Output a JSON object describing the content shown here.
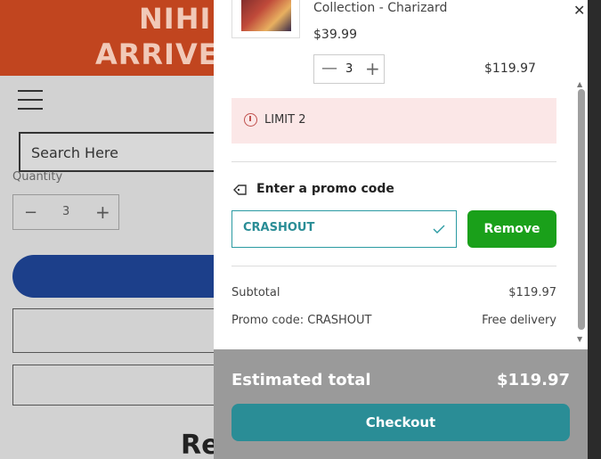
{
  "background": {
    "banner": {
      "line1": "NIHIL",
      "line2": "ARRIVE"
    },
    "search_placeholder": "Search Here",
    "quantity_label": "Quantity",
    "quantity_stepper": {
      "minus": "−",
      "value": "3",
      "plus": "+"
    },
    "heading_fragment": "Re"
  },
  "cart": {
    "item": {
      "title": "Collection - Charizard",
      "unit_price": "$39.99",
      "quantity": "3",
      "line_total": "$119.97"
    },
    "limit_notice": "LIMIT 2",
    "promo": {
      "title": "Enter a promo code",
      "code_value": "CRASHOUT",
      "remove_label": "Remove"
    },
    "summary": [
      {
        "label": "Subtotal",
        "value": "$119.97"
      },
      {
        "label": "Promo code: CRASHOUT",
        "value": "Free delivery"
      }
    ],
    "footer": {
      "estimated_label": "Estimated total",
      "estimated_value": "$119.97",
      "checkout_label": "Checkout"
    },
    "close_symbol": "✕",
    "stepper_minus": "—",
    "stepper_plus": "+"
  },
  "colors": {
    "banner": "#c1451f",
    "remove_button": "#1aa01a",
    "checkout_button": "#2a8d96",
    "limit_background": "#fbe7e7"
  },
  "icons": [
    "menu-icon",
    "close-icon",
    "info-icon",
    "tag-icon",
    "check-icon"
  ]
}
